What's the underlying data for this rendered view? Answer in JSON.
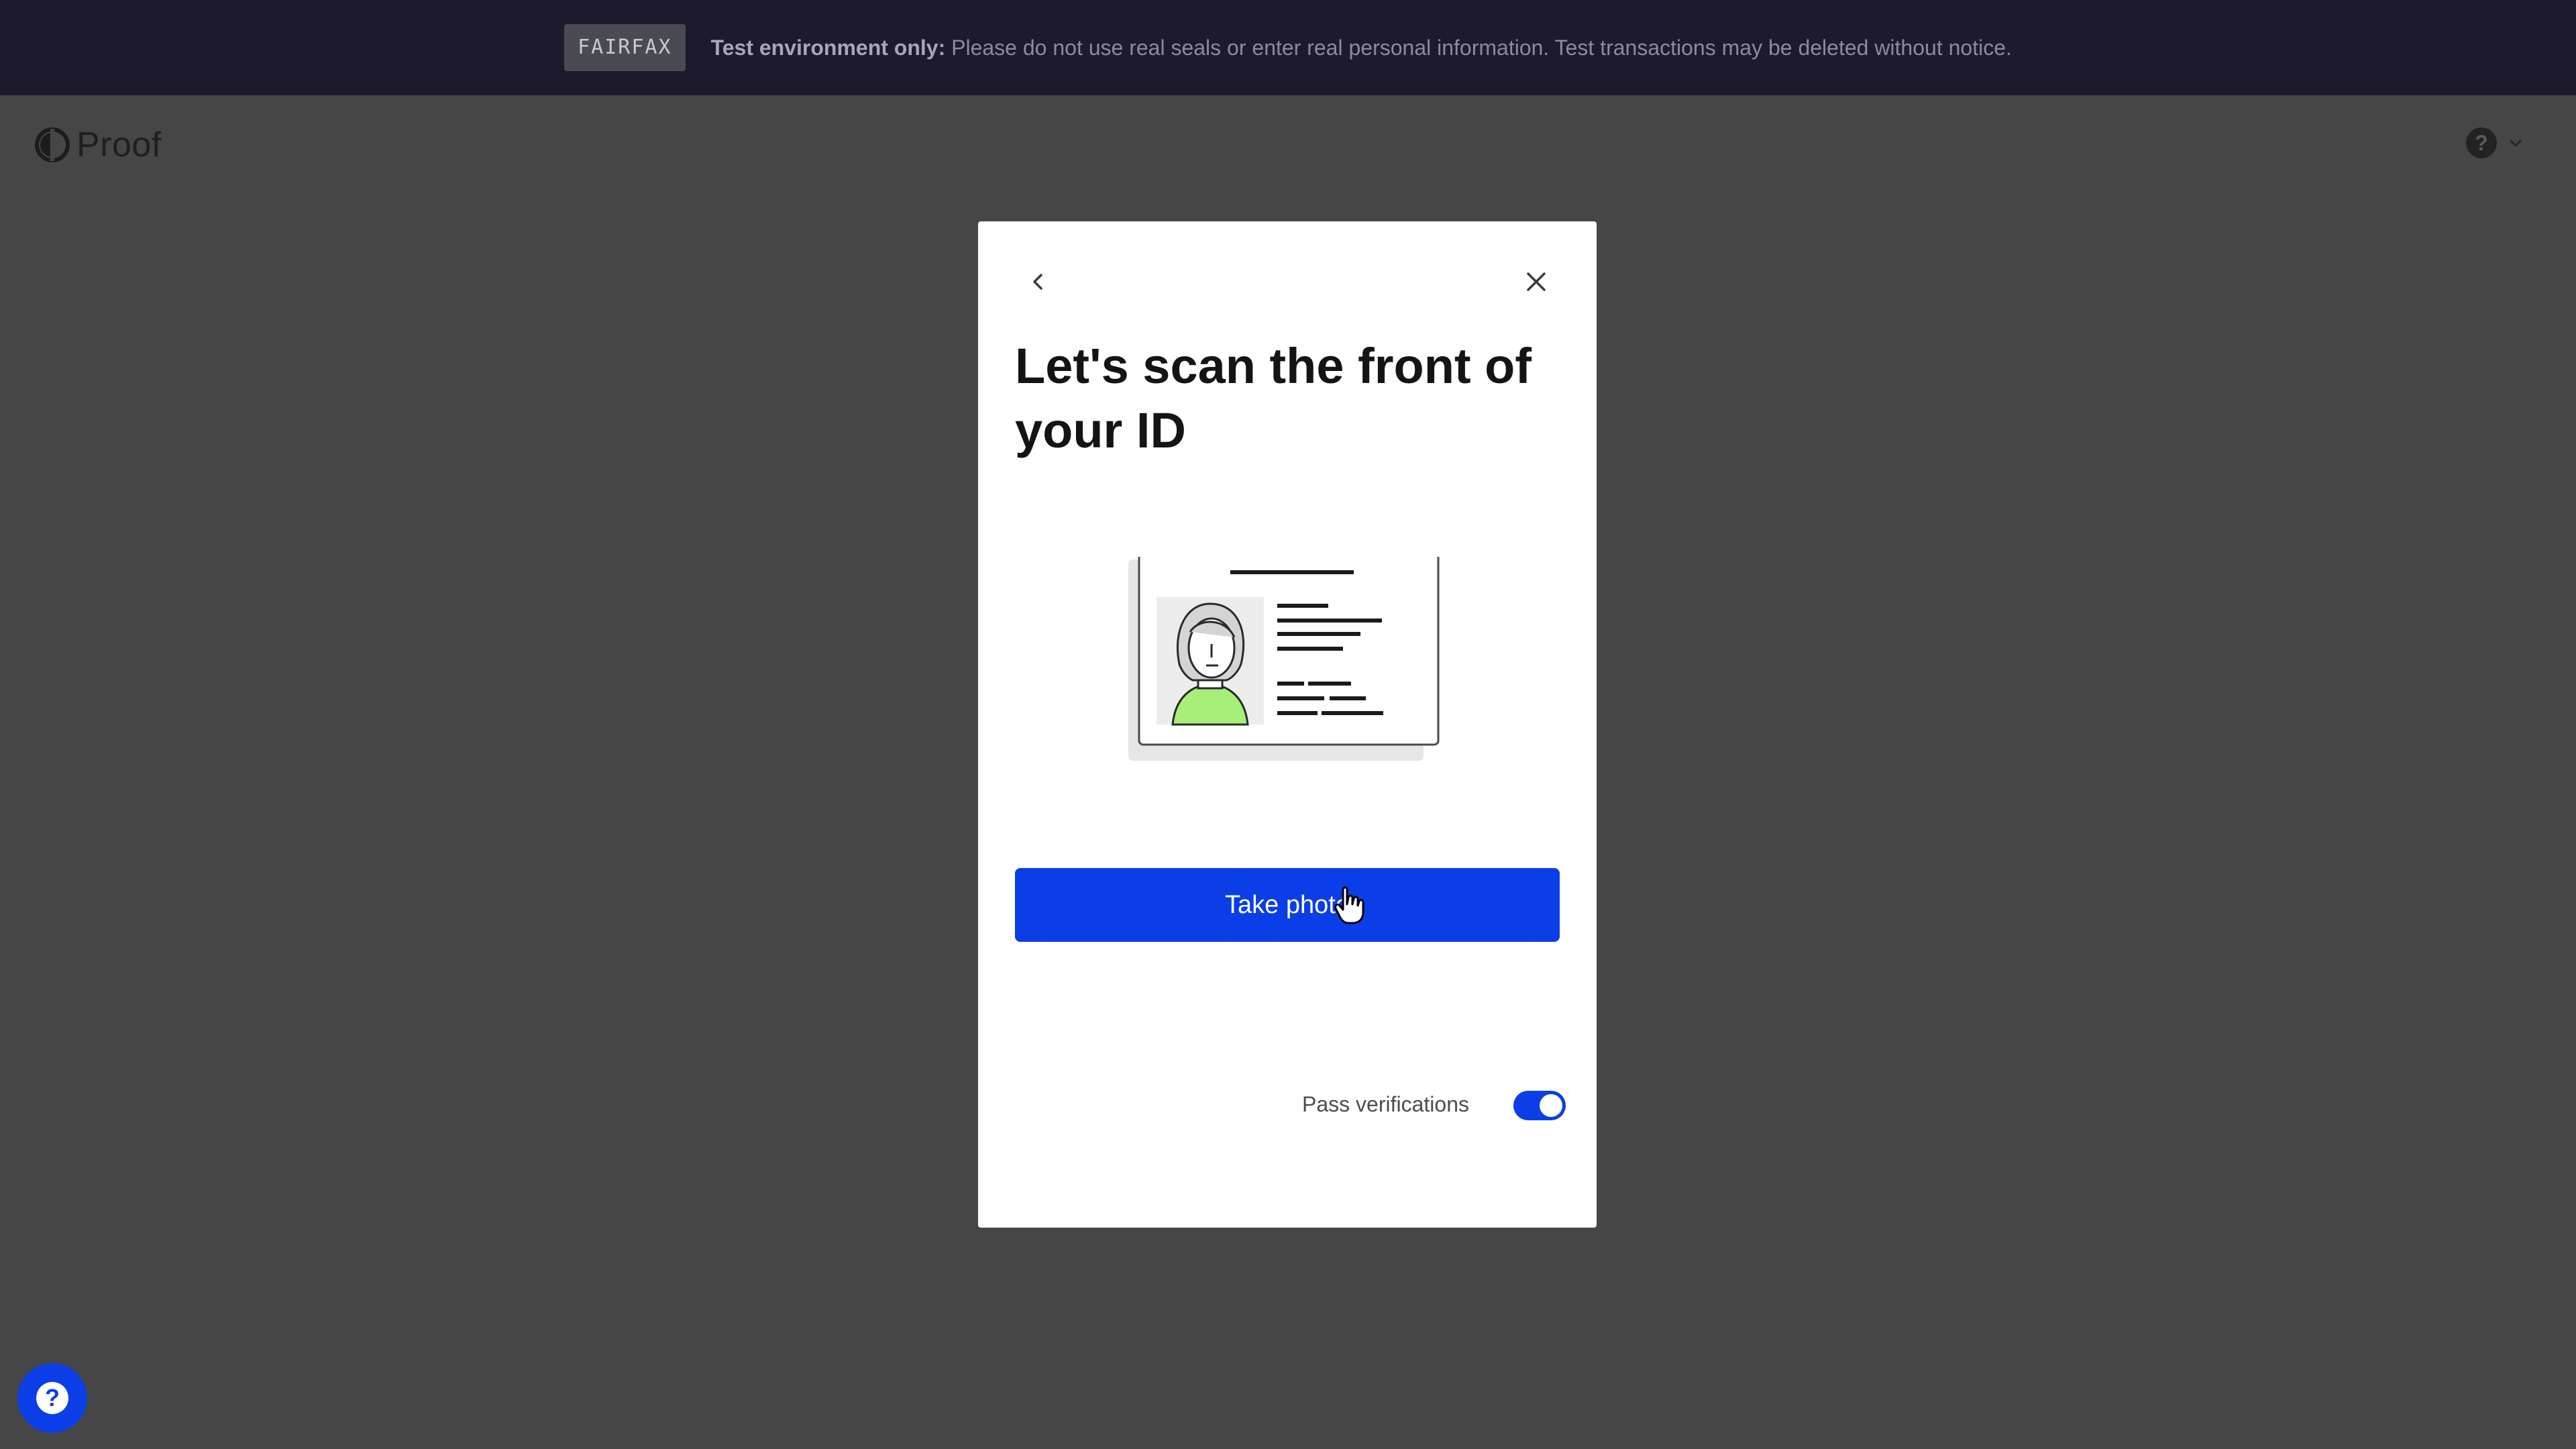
{
  "banner": {
    "tag": "FAIRFAX",
    "strong": "Test environment only:",
    "message": "Please do not use real seals or enter real personal information. Test transactions may be deleted without notice."
  },
  "header": {
    "logo_text": "Proof",
    "help_icon_glyph": "?"
  },
  "modal": {
    "title": "Let's scan the front of your ID",
    "take_photo_label": "Take photo",
    "pass_verifications_label": "Pass verifications",
    "pass_verifications_on": true
  },
  "help_fab": {
    "glyph": "?"
  },
  "colors": {
    "accent": "#0b3ee6",
    "backdrop": "#464646",
    "banner_bg": "#1d1a2e",
    "id_avatar_shirt": "#a6f07a"
  },
  "icons": {
    "back": "chevron-left-icon",
    "close": "close-icon",
    "help": "question-icon",
    "menu": "chevron-down-icon",
    "cursor": "pointer-hand-icon",
    "illustration": "id-card-illustration"
  }
}
